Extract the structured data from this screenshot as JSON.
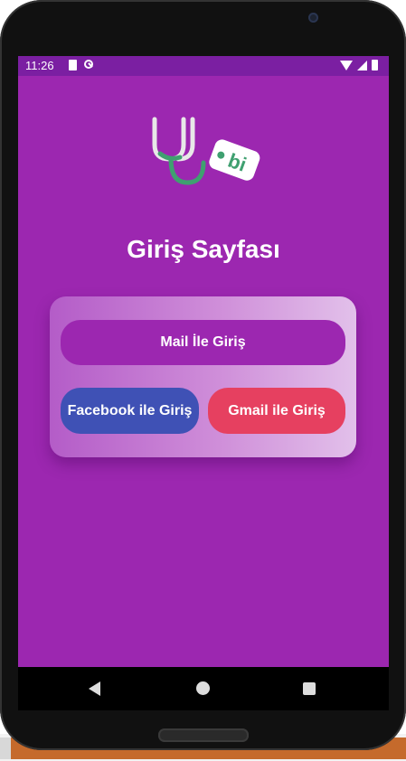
{
  "status_bar": {
    "time": "11:26"
  },
  "logo": {
    "text": "bi",
    "colors": {
      "stethoscope": "#3fa070",
      "tag": "#ffffff"
    }
  },
  "page": {
    "title": "Giriş Sayfası"
  },
  "buttons": {
    "mail": "Mail İle Giriş",
    "facebook": "Facebook ile Giriş",
    "gmail": "Gmail ile Giriş"
  },
  "colors": {
    "background": "#9c27b0",
    "status_bar": "#7b1fa2",
    "facebook": "#3f51b5",
    "gmail": "#e64060"
  },
  "icons": {
    "status_left": [
      "sim-card-icon",
      "blocked-icon"
    ],
    "status_right": [
      "wifi-icon",
      "signal-icon",
      "battery-icon"
    ],
    "nav": [
      "back-icon",
      "home-icon",
      "recents-icon"
    ]
  }
}
